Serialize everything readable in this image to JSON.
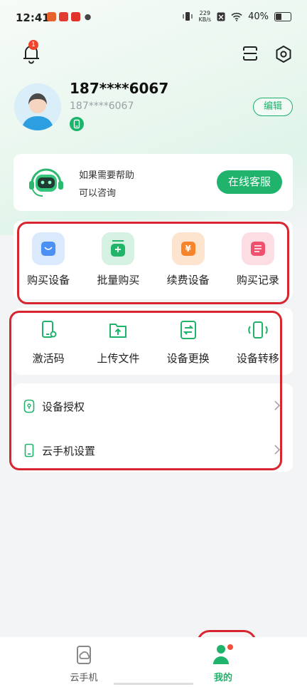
{
  "status_bar": {
    "time": "12:41",
    "net_speed_value": "229",
    "net_speed_unit": "KB/s",
    "battery": "40%"
  },
  "header": {
    "notification_count": "1"
  },
  "profile": {
    "phone_main": "187****6067",
    "phone_sub": "187****6067",
    "edit_label": "编辑"
  },
  "help": {
    "line1": "如果需要帮助",
    "line2": "可以咨询",
    "service_button": "在线客服"
  },
  "purchase_section": {
    "items": [
      {
        "label": "购买设备",
        "icon": "cart-icon",
        "color": "#4a90f5"
      },
      {
        "label": "批量购买",
        "icon": "batch-add-icon",
        "color": "#22b468"
      },
      {
        "label": "续费设备",
        "icon": "yen-icon",
        "color": "#f5842a"
      },
      {
        "label": "购买记录",
        "icon": "list-icon",
        "color": "#f0506e"
      }
    ]
  },
  "tools_section": {
    "items": [
      {
        "label": "激活码",
        "icon": "activation-code-icon"
      },
      {
        "label": "上传文件",
        "icon": "upload-folder-icon"
      },
      {
        "label": "设备更换",
        "icon": "device-swap-icon"
      },
      {
        "label": "设备转移",
        "icon": "device-transfer-icon"
      }
    ]
  },
  "settings_list": {
    "items": [
      {
        "label": "设备授权",
        "icon": "authorization-icon"
      },
      {
        "label": "云手机设置",
        "icon": "cloud-phone-settings-icon"
      }
    ]
  },
  "bottom_nav": {
    "tabs": [
      {
        "label": "云手机",
        "icon": "cloud-phone-icon",
        "active": false
      },
      {
        "label": "我的",
        "icon": "profile-icon",
        "active": true
      }
    ]
  },
  "colors": {
    "accent": "#1fb36c",
    "highlight": "#d7262f"
  }
}
